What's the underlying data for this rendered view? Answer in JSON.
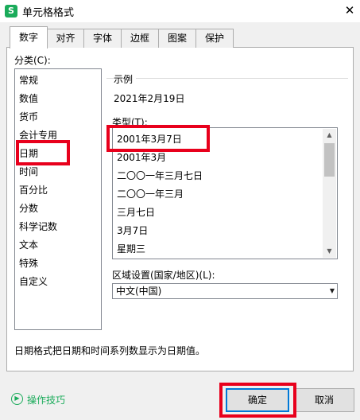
{
  "window": {
    "app_icon": "S",
    "title": "单元格格式",
    "close": "✕"
  },
  "tabs": [
    {
      "label": "数字",
      "active": true
    },
    {
      "label": "对齐"
    },
    {
      "label": "字体"
    },
    {
      "label": "边框"
    },
    {
      "label": "图案"
    },
    {
      "label": "保护"
    }
  ],
  "category": {
    "label": "分类(C):",
    "items": [
      "常规",
      "数值",
      "货币",
      "会计专用",
      "日期",
      "时间",
      "百分比",
      "分数",
      "科学记数",
      "文本",
      "特殊",
      "自定义"
    ],
    "selected": "日期"
  },
  "sample": {
    "label": "示例",
    "value": "2021年2月19日"
  },
  "type": {
    "label": "类型(T):",
    "items": [
      "2001年3月7日",
      "2001年3月",
      "二〇〇一年三月七日",
      "二〇〇一年三月",
      "三月七日",
      "3月7日",
      "星期三"
    ],
    "selected": "2001年3月7日"
  },
  "locale": {
    "label": "区域设置(国家/地区)(L):",
    "value": "中文(中国)"
  },
  "description": "日期格式把日期和时间系列数显示为日期值。",
  "footer": {
    "tips_label": "操作技巧",
    "ok": "确定",
    "cancel": "取消"
  },
  "colors": {
    "highlight": "#e8001c",
    "accent": "#1aab5a",
    "focus": "#0078d7"
  }
}
